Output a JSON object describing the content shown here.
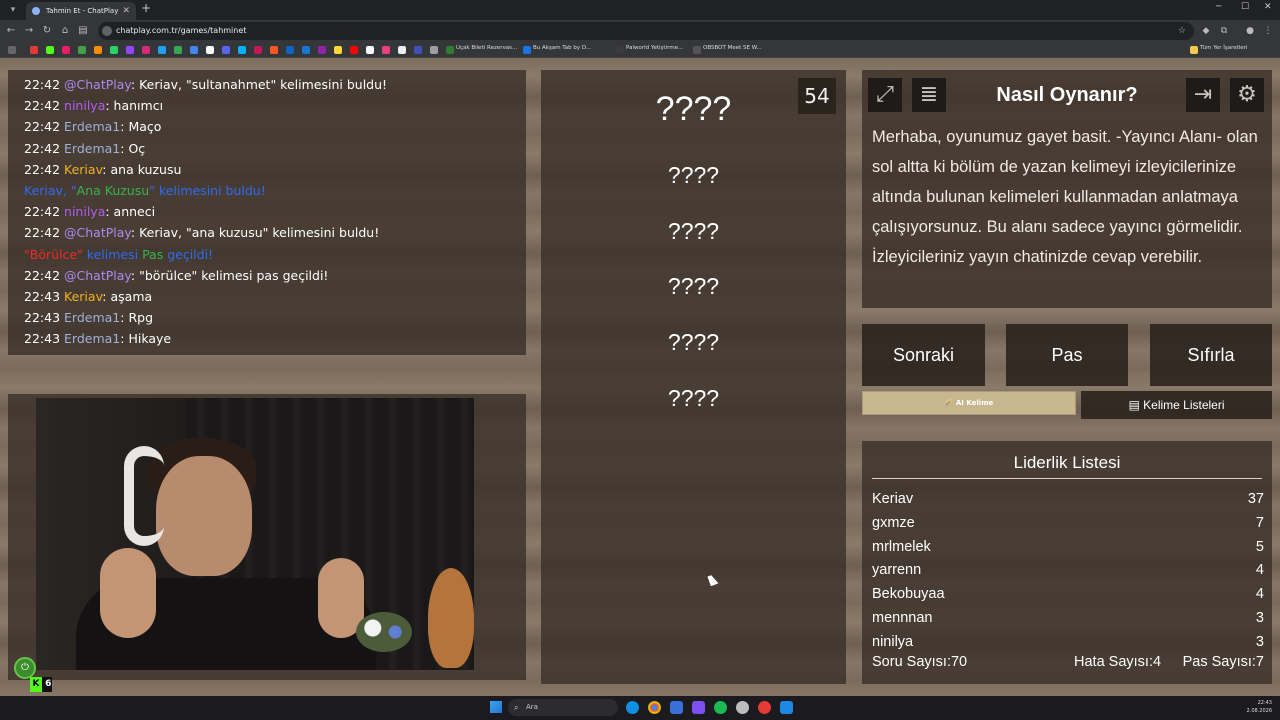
{
  "browser": {
    "tab_title": "Tahmin Et - ChatPlay",
    "url": "chatplay.com.tr/games/tahminet",
    "bookmarks": [
      {
        "label": "Uçak Bileti Rezervas...",
        "color": "#2e7d32"
      },
      {
        "label": "Bu Akşam Tab by D...",
        "color": "#1a73e8"
      },
      {
        "label": "Palworld Yetiştirme...",
        "color": "#3b3b3b"
      },
      {
        "label": "OBSBOT Meet SE W...",
        "color": "#333333"
      }
    ],
    "all_bookmarks_label": "Tüm Yer İşaretleri"
  },
  "chat": {
    "lines": [
      {
        "time": "22:42",
        "user": "@ChatPlay",
        "user_color": "#a88cf0",
        "text": ": Keriav, \"sultanahmet\" kelimesini buldu!"
      },
      {
        "time": "22:42",
        "user": "ninilya",
        "user_color": "#b35cf0",
        "text": ": hanımcı"
      },
      {
        "time": "22:42",
        "user": "Erdema1",
        "user_color": "#9fb0d9",
        "text": ": Maço"
      },
      {
        "time": "22:42",
        "user": "Erdema1",
        "user_color": "#9fb0d9",
        "text": ": Oç"
      },
      {
        "time": "22:42",
        "user": "Keriav",
        "user_color": "#f0b020",
        "text": ": ana kuzusu"
      },
      {
        "system_parts": [
          "Keriav, \"",
          "Ana Kuzusu",
          "\" kelimesini buldu!"
        ]
      },
      {
        "time": "22:42",
        "user": "ninilya",
        "user_color": "#b35cf0",
        "text": ": anneci"
      },
      {
        "time": "22:42",
        "user": "@ChatPlay",
        "user_color": "#a88cf0",
        "text": ": Keriav, \"ana kuzusu\" kelimesini buldu!"
      },
      {
        "pass_parts": [
          "\"Börülce\"",
          " kelimesi ",
          "Pas",
          " geçildi!"
        ]
      },
      {
        "time": "22:42",
        "user": "@ChatPlay",
        "user_color": "#a88cf0",
        "text": ": \"börülce\" kelimesi pas geçildi!"
      },
      {
        "time": "22:43",
        "user": "Keriav",
        "user_color": "#f0b020",
        "text": ": aşama"
      },
      {
        "time": "22:43",
        "user": "Erdema1",
        "user_color": "#9fb0d9",
        "text": ": Rpg"
      },
      {
        "time": "22:43",
        "user": "Erdema1",
        "user_color": "#9fb0d9",
        "text": ": Hikaye"
      }
    ]
  },
  "game": {
    "counter": "54",
    "main_word": "????",
    "hidden_words": [
      "????",
      "????",
      "????",
      "????",
      "????"
    ]
  },
  "howto": {
    "title": "Nasıl Oynanır?",
    "body": "Merhaba, oyunumuz gayet basit. -Yayıncı Alanı- olan sol altta ki bölüm de yazan kelimeyi izleyicilerinize altında bulunan kelimeleri kullanmadan anlatmaya çalışıyorsunuz. Bu alanı sadece yayıncı görmelidir. İzleyicileriniz yayın chatinizde cevap verebilir."
  },
  "controls": {
    "next": "Sonraki",
    "pass": "Pas",
    "reset": "Sıfırla",
    "ai_word": "🪄 AI Kelime",
    "word_lists": "Kelime Listeleri"
  },
  "leaderboard": {
    "title": "Liderlik Listesi",
    "rows": [
      {
        "name": "Keriav",
        "score": "37"
      },
      {
        "name": "gxmze",
        "score": "7"
      },
      {
        "name": "mrlmelek",
        "score": "5"
      },
      {
        "name": "yarrenn",
        "score": "4"
      },
      {
        "name": "Bekobuyaa",
        "score": "4"
      },
      {
        "name": "mennnan",
        "score": "3"
      },
      {
        "name": "ninilya",
        "score": "3"
      }
    ],
    "questions": "Soru Sayısı:70",
    "errors": "Hata Sayısı:4",
    "passes": "Pas Sayısı:7"
  },
  "kick_badge": {
    "letter": "K",
    "count": "6"
  },
  "taskbar": {
    "search_placeholder": "Ara",
    "time": "22:43",
    "date": "2.08.2026"
  }
}
